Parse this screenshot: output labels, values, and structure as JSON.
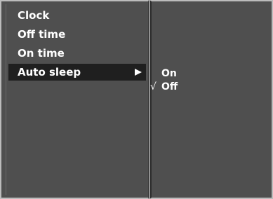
{
  "menu": {
    "items": [
      {
        "label": "Clock"
      },
      {
        "label": "Off time"
      },
      {
        "label": "On time"
      },
      {
        "label": "Auto sleep"
      }
    ],
    "selected_index": 3,
    "submenu_indicator_icon": "triangle-right-icon"
  },
  "submenu": {
    "options": [
      {
        "label": "On",
        "checked": false
      },
      {
        "label": "Off",
        "checked": true
      }
    ],
    "check_mark": "√"
  },
  "colors": {
    "panel_bg": "#4f4f4f",
    "selected_bg": "#1f1f1f",
    "text": "#ffffff",
    "frame": "#bcbcbc"
  }
}
